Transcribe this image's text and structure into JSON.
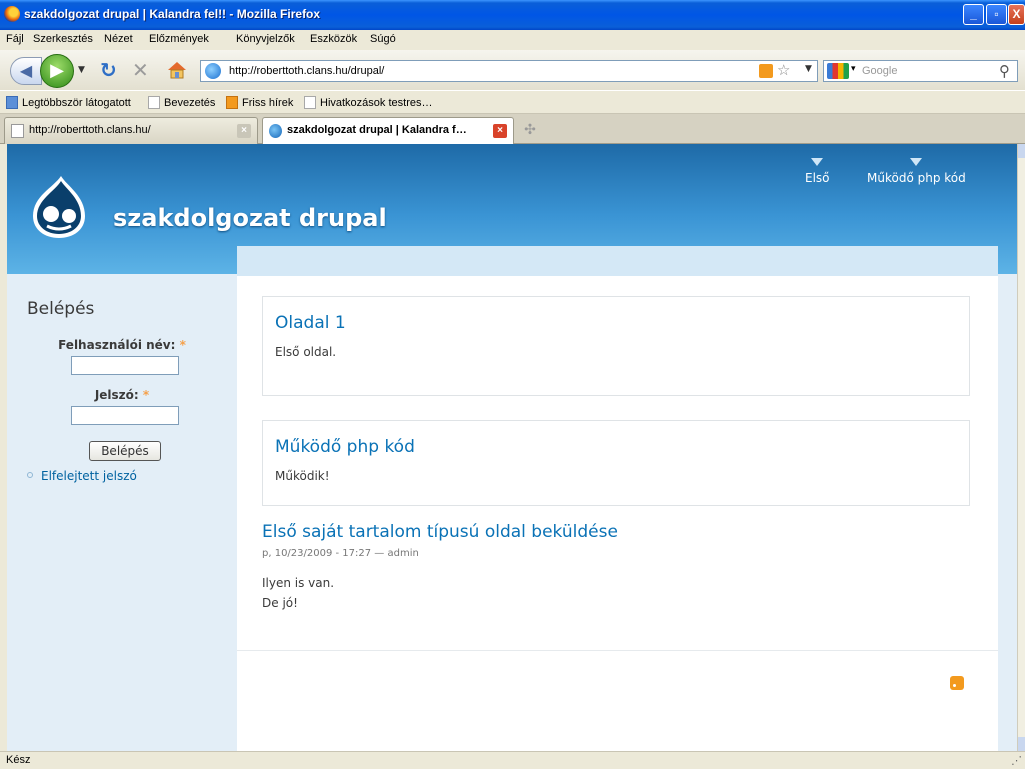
{
  "window": {
    "title": "szakdolgozat drupal | Kalandra fel!! - Mozilla Firefox",
    "minimize": "_",
    "maximize": "▫",
    "close": "X"
  },
  "menu": [
    "Fájl",
    "Szerkesztés",
    "Nézet",
    "Előzmények",
    "Könyvjelzők",
    "Eszközök",
    "Súgó"
  ],
  "toolbar": {
    "url": "http://roberttoth.clans.hu/drupal/",
    "search_placeholder": "Google"
  },
  "bookmarks": [
    "Legtöbbször látogatott",
    "Bevezetés",
    "Friss hírek",
    "Hivatkozások testres…"
  ],
  "tabs": [
    {
      "label": "http://roberttoth.clans.hu/",
      "active": false
    },
    {
      "label": "szakdolgozat drupal | Kalandra f…",
      "active": true
    }
  ],
  "site": {
    "name": "szakdolgozat drupal",
    "primary_nav": [
      "Első",
      "Működő php kód"
    ]
  },
  "sidebar": {
    "title": "Belépés",
    "username_label": "Felhasználói név:",
    "password_label": "Jelszó:",
    "required_mark": "*",
    "login_button": "Belépés",
    "forgot_link": "Elfelejtett jelszó"
  },
  "nodes": [
    {
      "title": "Oladal 1",
      "body": "Első oldal."
    },
    {
      "title": "Működő php kód",
      "body": "Működik!"
    },
    {
      "title": "Első saját tartalom típusú oldal beküldése",
      "meta": "p, 10/23/2009 - 17:27 — admin",
      "lines": [
        "Ilyen is van.",
        "De jó!"
      ]
    }
  ],
  "status": "Kész",
  "colors": {
    "accent": "#0a72b6",
    "header": "#2a84c6",
    "required": "#f5a04a",
    "feed": "#f39a1e"
  }
}
